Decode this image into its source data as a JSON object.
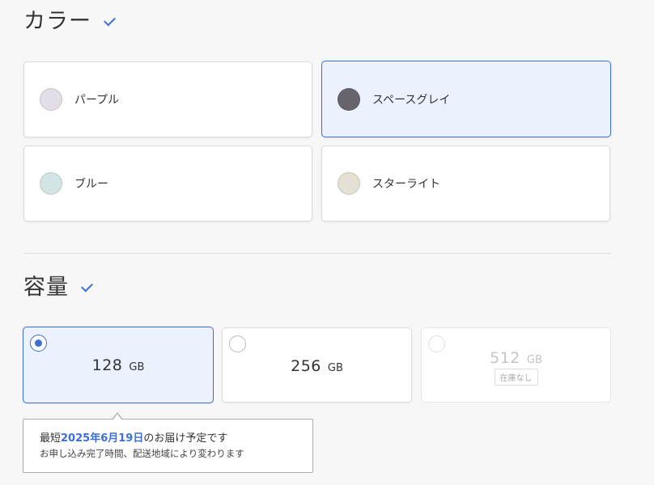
{
  "color_section": {
    "title": "カラー",
    "options": [
      {
        "label": "パープル",
        "swatch": "#e3dde8",
        "selected": false
      },
      {
        "label": "スペースグレイ",
        "swatch": "#67656b",
        "selected": true
      },
      {
        "label": "ブルー",
        "swatch": "#d3e4e5",
        "selected": false
      },
      {
        "label": "スターライト",
        "swatch": "#e5e0d4",
        "selected": false
      }
    ]
  },
  "capacity_section": {
    "title": "容量",
    "options": [
      {
        "value": "128",
        "unit": "GB",
        "selected": true,
        "available": true
      },
      {
        "value": "256",
        "unit": "GB",
        "selected": false,
        "available": true
      },
      {
        "value": "512",
        "unit": "GB",
        "selected": false,
        "available": false,
        "badge": "在庫なし"
      }
    ]
  },
  "delivery_tooltip": {
    "prefix": "最短",
    "date": "2025年6月19日",
    "suffix": "のお届け予定です",
    "note": "お申し込み完了時間、配送地域により変わります"
  },
  "colors": {
    "accent": "#3b6fd4",
    "selected_bg": "#ebf1fd"
  }
}
